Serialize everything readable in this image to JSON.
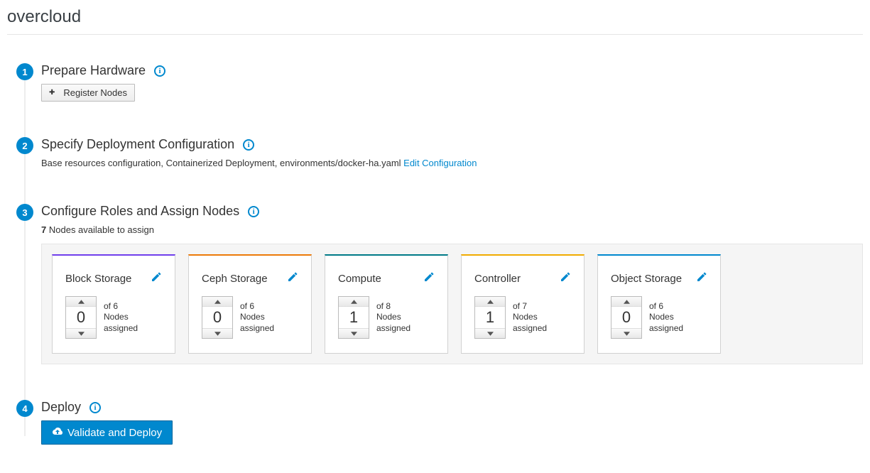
{
  "page_title": "overcloud",
  "steps": {
    "s1": {
      "num": "1",
      "title": "Prepare Hardware",
      "register_btn": "Register Nodes"
    },
    "s2": {
      "num": "2",
      "title": "Specify Deployment Configuration",
      "desc": "Base resources configuration, Containerized Deployment, environments/docker-ha.yaml",
      "edit_link": "Edit Configuration"
    },
    "s3": {
      "num": "3",
      "title": "Configure Roles and Assign Nodes",
      "available_count": "7",
      "available_text": "Nodes available to assign",
      "of_label": "of",
      "assigned_label1": "Nodes",
      "assigned_label2": "assigned",
      "roles": [
        {
          "name": "Block Storage",
          "value": "0",
          "of": "6",
          "accent": "purple"
        },
        {
          "name": "Ceph Storage",
          "value": "0",
          "of": "6",
          "accent": "orange"
        },
        {
          "name": "Compute",
          "value": "1",
          "of": "8",
          "accent": "teal"
        },
        {
          "name": "Controller",
          "value": "1",
          "of": "7",
          "accent": "gold"
        },
        {
          "name": "Object Storage",
          "value": "0",
          "of": "6",
          "accent": "blue"
        }
      ]
    },
    "s4": {
      "num": "4",
      "title": "Deploy",
      "deploy_btn": "Validate and Deploy"
    }
  }
}
